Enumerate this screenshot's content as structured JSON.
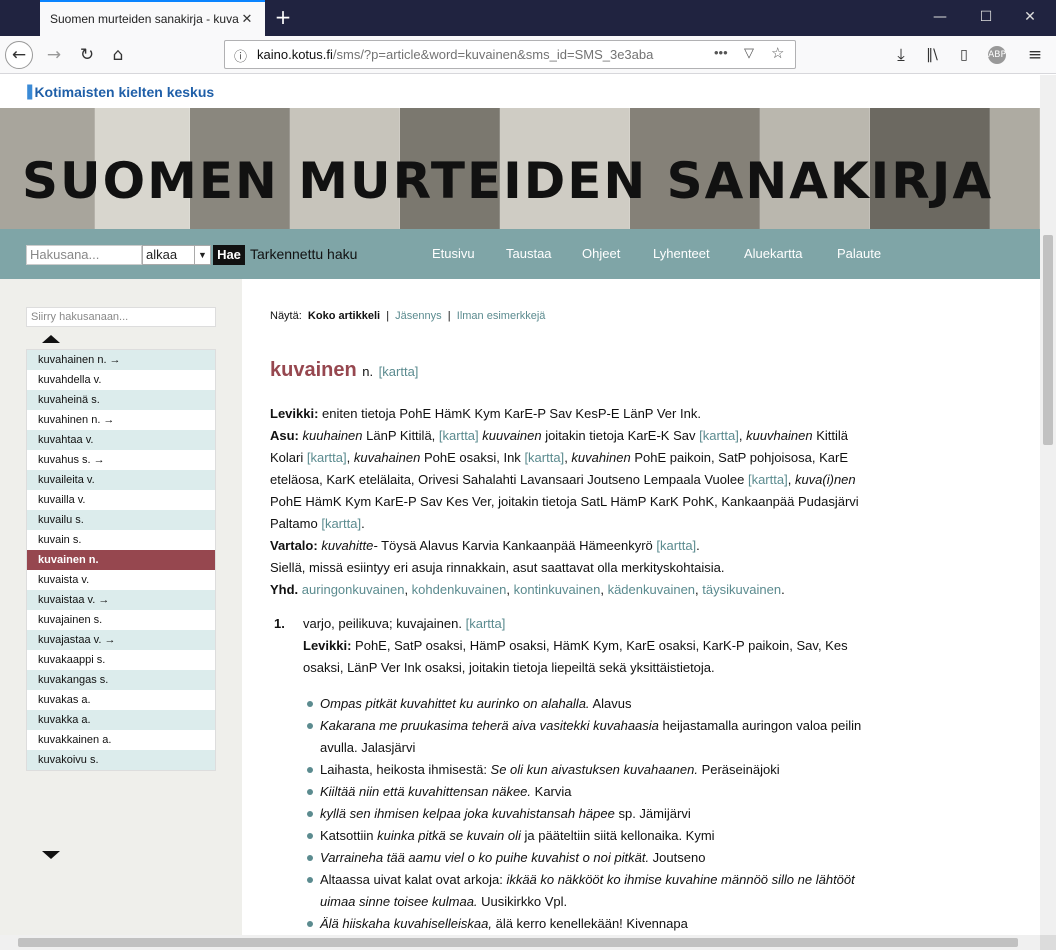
{
  "browser": {
    "tab_title": "Suomen murteiden sanakirja - kuva",
    "url_host": "kaino.kotus.fi",
    "url_path": "/sms/?p=article&word=kuvainen&sms_id=SMS_3e3aba"
  },
  "site": {
    "logo_text": "Kotimaisten kielten keskus",
    "banner_title": "SUOMEN MURTEIDEN SANAKIRJA",
    "search_placeholder": "Hakusana...",
    "search_mode": "alkaa",
    "search_button": "Hae",
    "advanced_search": "Tarkennettu haku",
    "nav": [
      "Etusivu",
      "Taustaa",
      "Ohjeet",
      "Lyhenteet",
      "Aluekartta",
      "Palaute"
    ]
  },
  "sidebar": {
    "jump_placeholder": "Siirry hakusanaan...",
    "words": [
      "kuvahainen n. →",
      "kuvahdella v.",
      "kuvaheinä s.",
      "kuvahinen n. →",
      "kuvahtaa v.",
      "kuvahus s. →",
      "kuvaileita v.",
      "kuvailla v.",
      "kuvailu s.",
      "kuvain s.",
      "kuvainen n.",
      "kuvaista v.",
      "kuvaistaa v. →",
      "kuvajainen s.",
      "kuvajastaa v. →",
      "kuvakaappi s.",
      "kuvakangas s.",
      "kuvakas a.",
      "kuvakka a.",
      "kuvakkainen a.",
      "kuvakoivu s."
    ]
  },
  "article": {
    "show_label": "Näytä:",
    "show_full": "Koko artikkeli",
    "show_members": "Jäsennys",
    "show_no_examples": "Ilman esimerkkejä",
    "separator": "|",
    "headword": "kuvainen",
    "pos": "n.",
    "map": "[kartta]",
    "levikki_label": "Levikki:",
    "levikki_text": "eniten tietoja PohE HämK Kym KarE-P Sav KesP-E LänP Ver Ink.",
    "asu_label": "Asu:",
    "asu_f1": "kuuhainen",
    "asu_t1": "LänP Kittilä,",
    "asu_f2": "kuuvainen",
    "asu_t2": "joitakin tietoja KarE-K Sav",
    "asu_f3": "kuuvhainen",
    "asu_t3": "Kittilä Kolari",
    "asu_f4": "kuvahainen",
    "asu_t4": "PohE osaksi, Ink",
    "asu_f5": "kuvahinen",
    "asu_t5": "PohE paikoin, SatP pohjoisosa, KarE eteläosa, KarK etelälaita, Orivesi Sahalahti Lavansaari Joutseno Lempaala Vuolee",
    "asu_f6": "kuva(i)nen",
    "asu_t6": "PohE HämK Kym KarE-P Sav Kes Ver, joitakin tietoja SatL HämP KarK PohK, Kankaanpää Pudasjärvi Paltamo",
    "vartalo_label": "Vartalo:",
    "vartalo_form": "kuvahitte-",
    "vartalo_text": "Töysä Alavus Karvia Kankaanpää Hämeenkyrö",
    "note": "Siellä, missä esiintyy eri asuja rinnakkain, asut saattavat olla merkityskohtaisia.",
    "yhd_label": "Yhd.",
    "compounds": [
      "auringonkuvainen",
      "kohdenkuvainen",
      "kontinkuvainen",
      "kädenkuvainen",
      "täysikuvainen"
    ],
    "def_num": "1.",
    "def_text": "varjo, peilikuva; kuvajainen.",
    "def_levikki_label": "Levikki:",
    "def_levikki": "PohE, SatP osaksi, HämP osaksi, HämK Kym, KarE osaksi, KarK-P paikoin, Sav, Kes osaksi, LänP Ver Ink osaksi, joitakin tietoja liepeiltä sekä yksittäistietoja.",
    "examples": [
      {
        "pre": "",
        "it": "Ompas pitkät kuvahittet ku aurinko on alahalla.",
        "post": " Alavus"
      },
      {
        "pre": "",
        "it": "Kakarana me pruukasima teherä aiva vasitekki kuvahaasia",
        "post": " heijastamalla auringon valoa peilin avulla. Jalasjärvi"
      },
      {
        "pre": "Laihasta, heikosta ihmisestä: ",
        "it": "Se oli kun aivastuksen kuvahaanen.",
        "post": " Peräseinäjoki"
      },
      {
        "pre": "",
        "it": "Kiiltää niin että kuvahittensan näkee.",
        "post": " Karvia"
      },
      {
        "pre": "",
        "it": "kyllä sen ihmisen kelpaa joka kuvahistansah häpee",
        "post": " sp. Jämijärvi"
      },
      {
        "pre": "Katsottiin ",
        "it": "kuinka pitkä se kuvain oli",
        "post": " ja pääteltiin siitä kellonaika. Kymi"
      },
      {
        "pre": "",
        "it": "Varraineha tää aamu viel o ko puihe kuvahist o noi pitkät.",
        "post": " Joutseno"
      },
      {
        "pre": "Altaassa uivat kalat ovat arkoja: ",
        "it": "ikkää ko näkkööt ko ihmise kuvahine männöö sillo ne lähtööt uimaa sinne toisee kulmaa.",
        "post": " Uusikirkko Vpl."
      },
      {
        "pre": "",
        "it": "Älä hiiskaha kuvahiselleiskaa,",
        "post": " älä kerro kenellekään! Kivennapa"
      }
    ]
  }
}
